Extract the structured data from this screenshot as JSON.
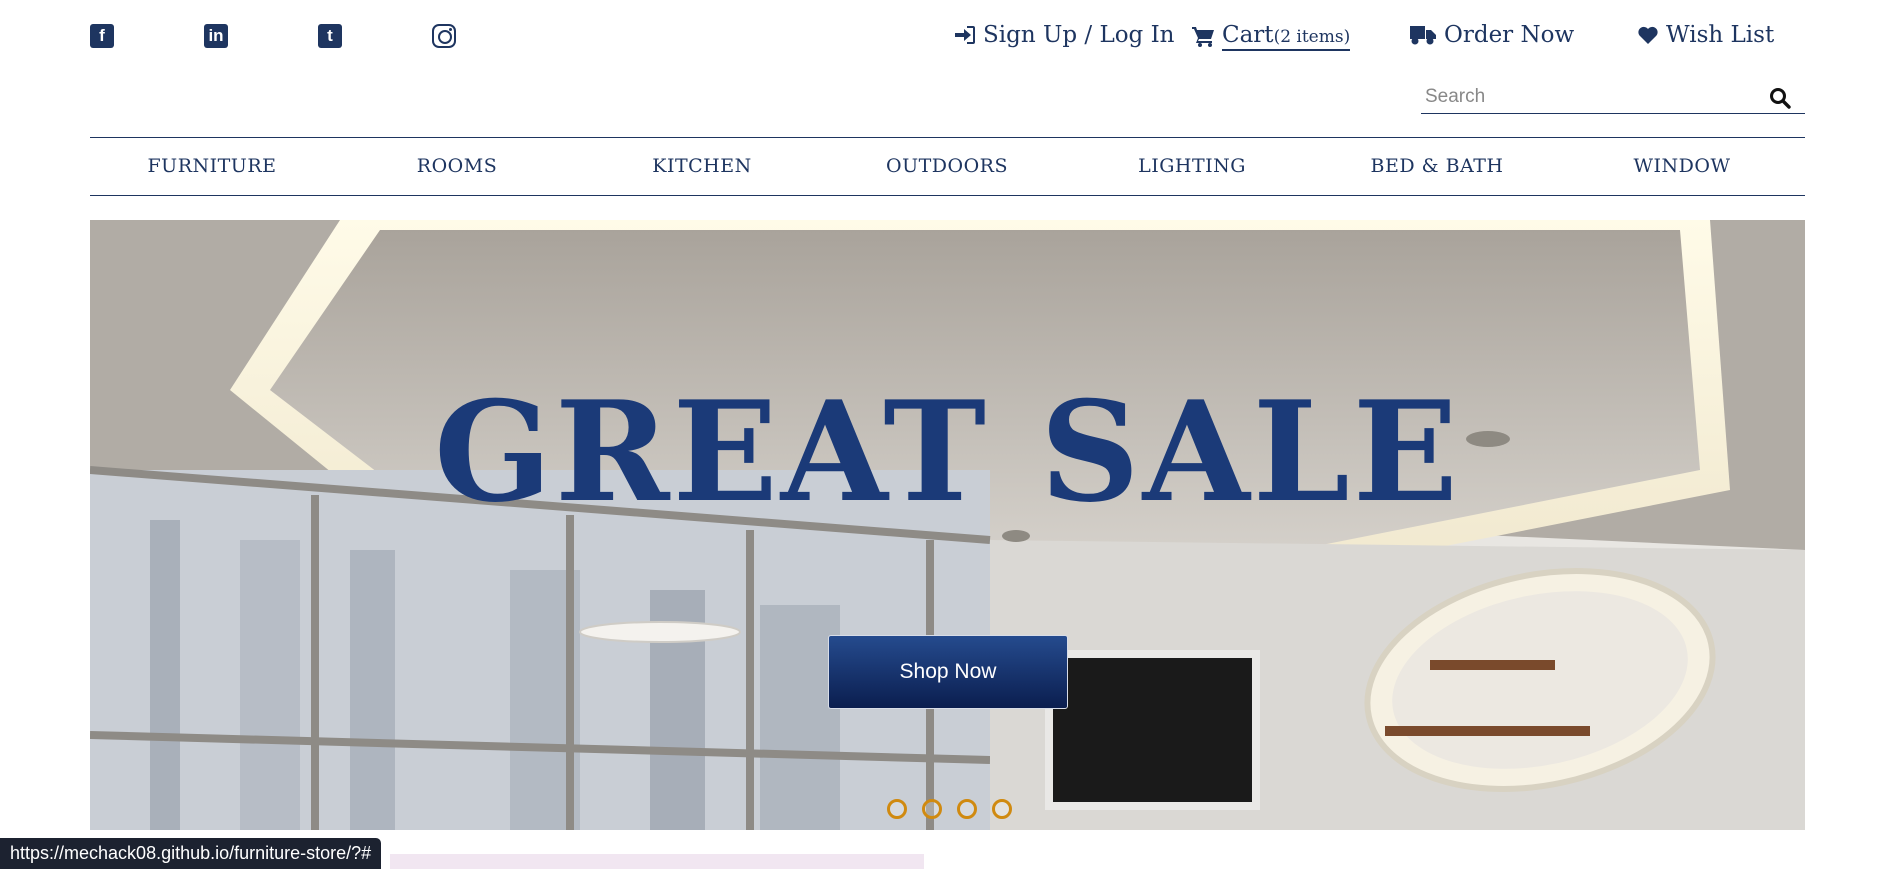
{
  "social_icons": [
    "facebook-icon",
    "linkedin-icon",
    "twitter-icon",
    "instagram-icon"
  ],
  "topnav": {
    "signin": "Sign Up / Log In",
    "cart_label": "Cart",
    "cart_count": "(2 items)",
    "order": "Order Now",
    "wishlist": "Wish List"
  },
  "search": {
    "placeholder": "Search"
  },
  "categories": [
    "FURNITURE",
    "ROOMS",
    "KITCHEN",
    "OUTDOORS",
    "LIGHTING",
    "BED & BATH",
    "WINDOW"
  ],
  "hero": {
    "title": "GREAT SALE",
    "button": "Shop Now",
    "slides": 4
  },
  "status_url": "https://mechack08.github.io/furniture-store/?#",
  "colors": {
    "brand": "#1e3560",
    "hero_title": "#1b3a78",
    "dot_accent": "#d08a10"
  }
}
